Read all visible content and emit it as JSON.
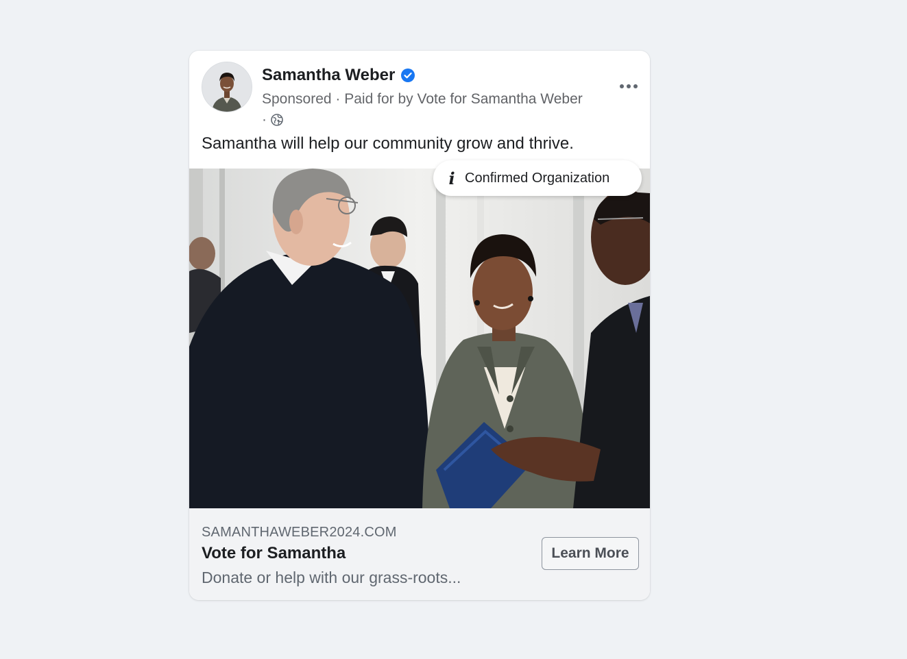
{
  "post": {
    "author_name": "Samantha Weber",
    "meta_sponsored": "Sponsored",
    "meta_separator": " · ",
    "meta_paid_prefix": "Paid for by ",
    "meta_paid_by": "Vote for Samantha Weber",
    "meta_audience_separator": " · ",
    "caption": "Samantha will help our community grow and thrive."
  },
  "badge": {
    "label": "Confirmed Organization",
    "icon": "info-icon"
  },
  "link_preview": {
    "domain": "SAMANTHAWEBER2024.COM",
    "headline": "Vote for Samantha",
    "description": "Donate or help with our grass-roots...",
    "cta_label": "Learn More"
  },
  "icons": {
    "verified": "verified-badge-icon",
    "audience": "globe-icon",
    "more": "more-options-icon"
  },
  "colors": {
    "verified_blue": "#1877f2",
    "page_background": "#eff2f5"
  }
}
